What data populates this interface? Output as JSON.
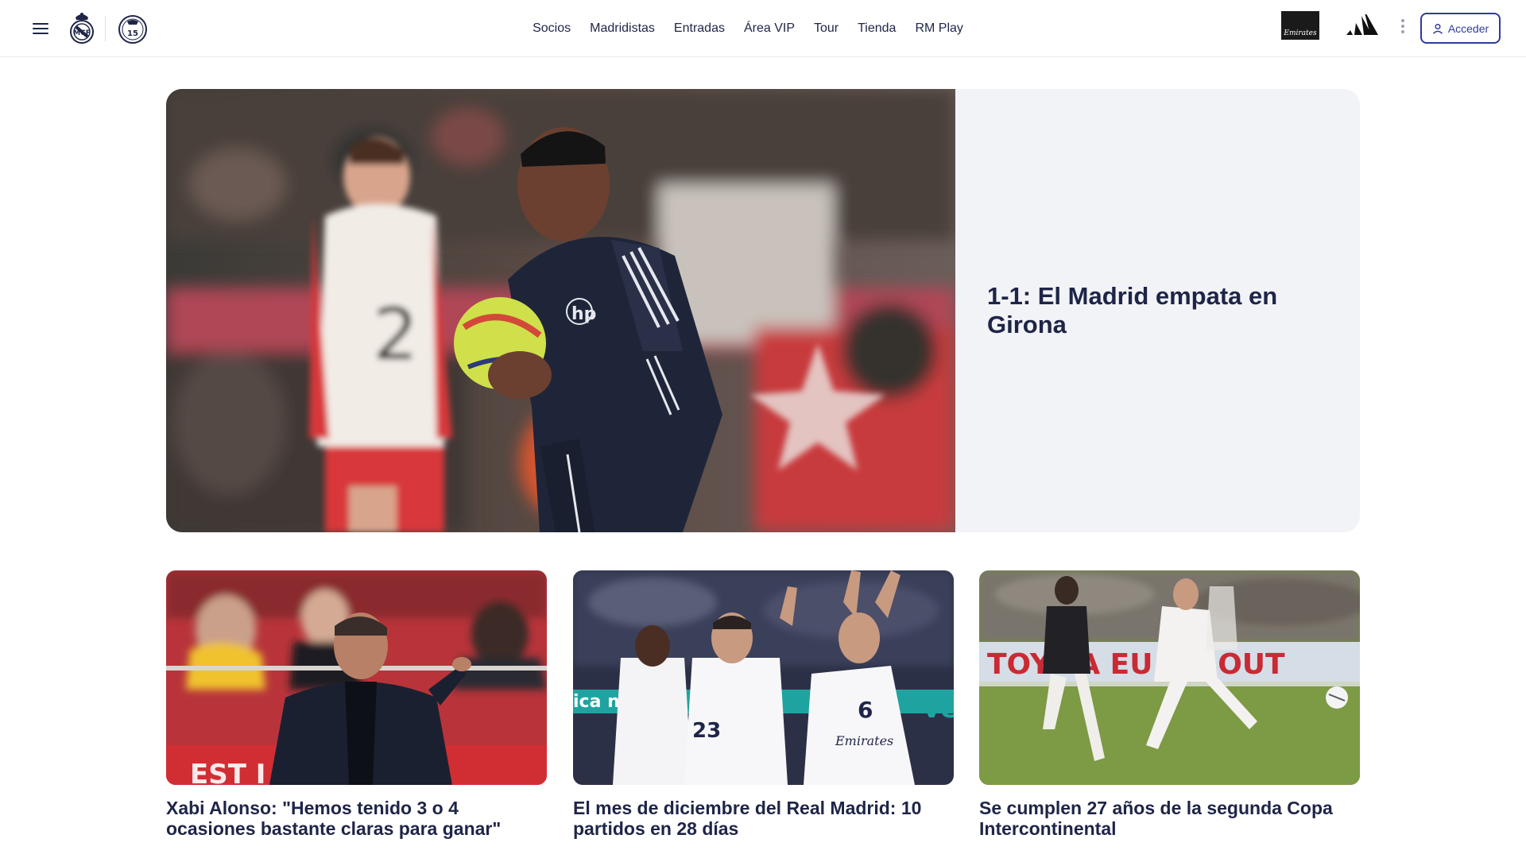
{
  "header": {
    "nav": [
      "Socios",
      "Madridistas",
      "Entradas",
      "Área VIP",
      "Tour",
      "Tienda",
      "RM Play"
    ],
    "badge_number": "15",
    "sponsor_text": "Emirates",
    "login_label": "Acceder",
    "icons": [
      "menu-icon",
      "club-crest-icon",
      "fifteen-cups-badge-icon",
      "emirates-logo",
      "adidas-logo",
      "more-vertical-icon",
      "user-icon"
    ]
  },
  "hero": {
    "title": "1-1: El Madrid empata en Girona",
    "background_color": "#f2f3f7"
  },
  "cards": [
    {
      "title": "Xabi Alonso: \"Hemos tenido 3 o 4 ocasiones bastante claras para ganar\""
    },
    {
      "title": "El mes de diciembre del Real Madrid: 10 partidos en 28 días"
    },
    {
      "title": "Se cumplen 27 años de la segunda Copa Intercontinental"
    }
  ],
  "colors": {
    "text": "#1e2547",
    "accent": "#2f3b9a",
    "border": "#e6e8ee"
  }
}
